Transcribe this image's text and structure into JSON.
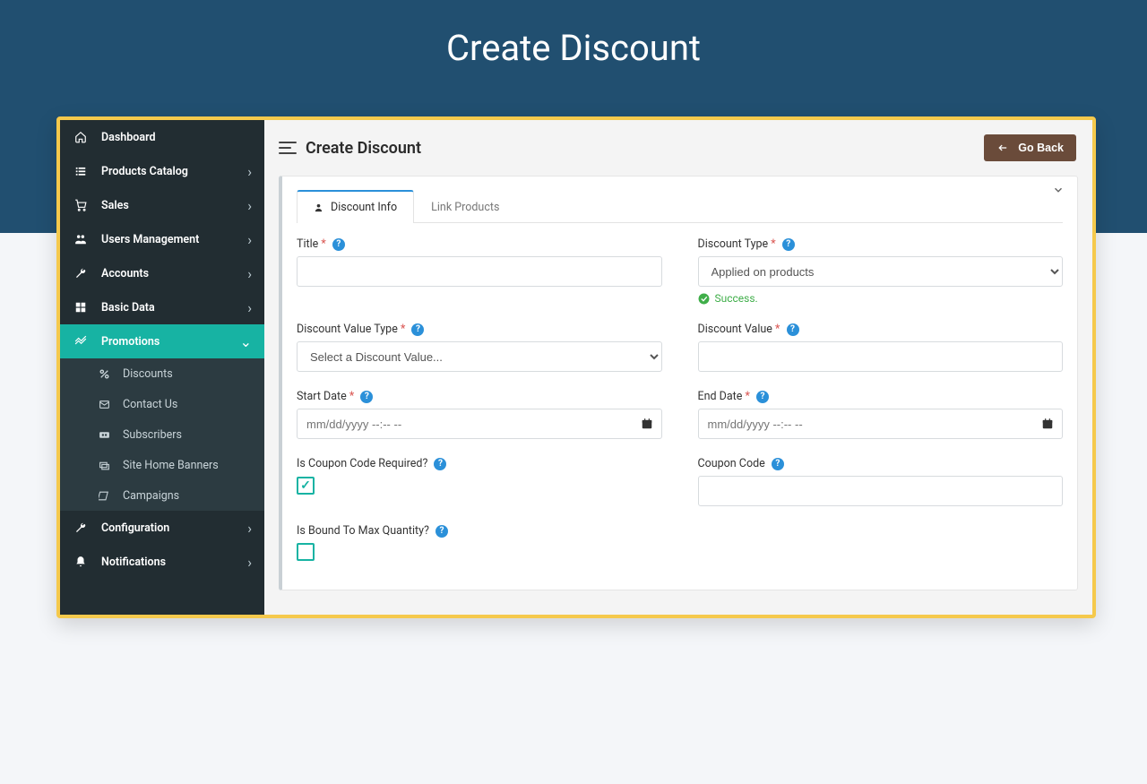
{
  "hero": {
    "title": "Create Discount"
  },
  "topbar": {
    "page_title": "Create Discount",
    "go_back": "Go Back"
  },
  "sidebar": {
    "items": [
      {
        "label": "Dashboard"
      },
      {
        "label": "Products Catalog"
      },
      {
        "label": "Sales"
      },
      {
        "label": "Users Management"
      },
      {
        "label": "Accounts"
      },
      {
        "label": "Basic Data"
      },
      {
        "label": "Promotions"
      },
      {
        "label": "Configuration"
      },
      {
        "label": "Notifications"
      }
    ],
    "promotions_sub": [
      {
        "label": "Discounts"
      },
      {
        "label": "Contact Us"
      },
      {
        "label": "Subscribers"
      },
      {
        "label": "Site Home Banners"
      },
      {
        "label": "Campaigns"
      }
    ]
  },
  "tabs": {
    "discount_info": "Discount Info",
    "link_products": "Link Products"
  },
  "form": {
    "title_label": "Title",
    "discount_type_label": "Discount Type",
    "discount_type_value": "Applied on products",
    "discount_type_success": "Success.",
    "discount_value_type_label": "Discount Value Type",
    "discount_value_type_placeholder": "Select a Discount Value...",
    "discount_value_label": "Discount Value",
    "start_date_label": "Start Date",
    "end_date_label": "End Date",
    "date_placeholder": "mm/dd/yyyy --:-- --",
    "coupon_required_label": "Is Coupon Code Required?",
    "coupon_code_label": "Coupon Code",
    "bound_max_label": "Is Bound To Max Quantity?"
  }
}
